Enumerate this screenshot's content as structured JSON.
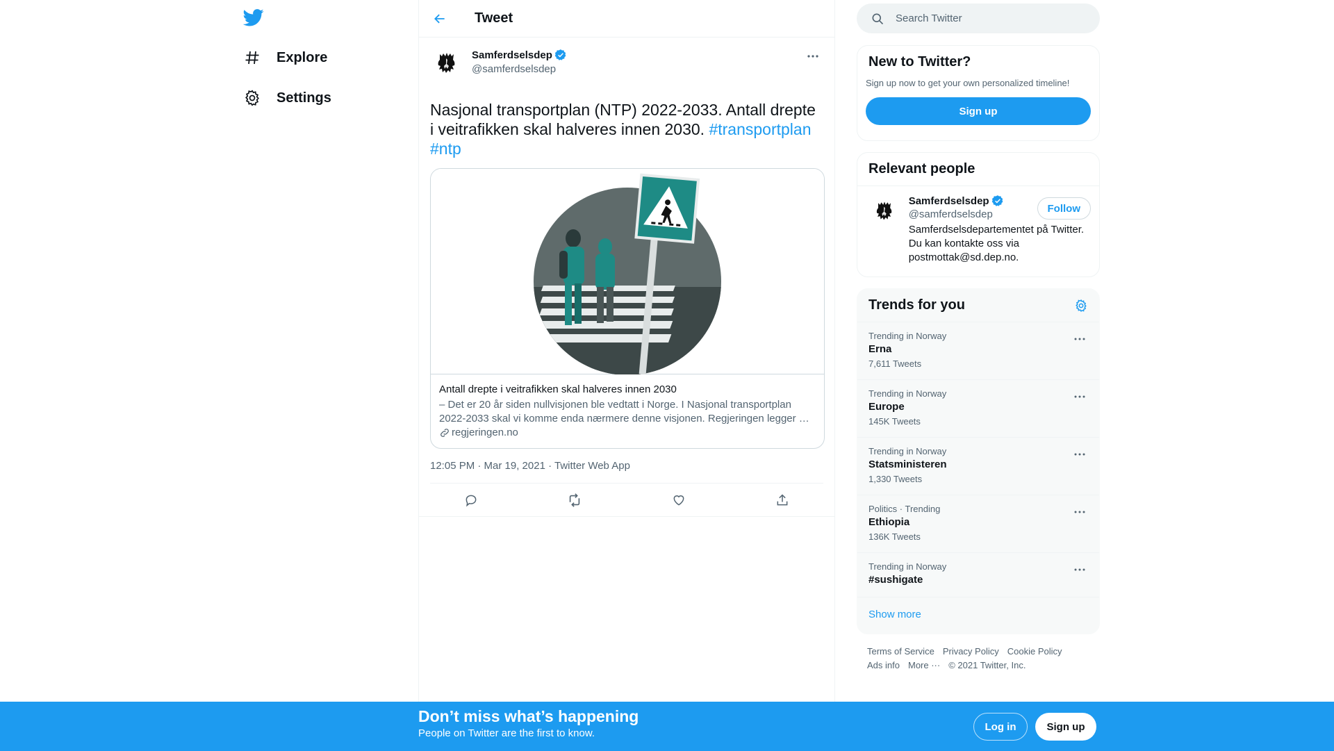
{
  "nav": {
    "explore_label": "Explore",
    "settings_label": "Settings"
  },
  "header": {
    "title": "Tweet"
  },
  "tweet": {
    "author_name": "Samferdselsdep",
    "author_handle": "@samferdselsdep",
    "text": "Nasjonal transportplan (NTP) 2022-2033. Antall drepte i veitrafikken skal halveres innen 2030. ",
    "hashtags": [
      "#transportplan",
      "#ntp"
    ],
    "card": {
      "title": "Antall drepte i veitrafikken skal halveres innen 2030",
      "description": "– Det er 20 år siden nullvisjonen ble vedtatt i Norge. I Nasjonal transportplan 2022-2033 skal vi komme enda nærmere denne visjonen. Regjeringen legger …",
      "domain": "regjeringen.no"
    },
    "timestamp": "12:05 PM · Mar 19, 2021 · Twitter Web App"
  },
  "search": {
    "placeholder": "Search Twitter"
  },
  "new_to_twitter": {
    "title": "New to Twitter?",
    "subtitle": "Sign up now to get your own personalized timeline!",
    "signup_label": "Sign up"
  },
  "relevant_people": {
    "title": "Relevant people",
    "person": {
      "name": "Samferdselsdep",
      "handle": "@samferdselsdep",
      "bio": "Samferdselsdepartementet på Twitter. Du kan kontakte oss via postmottak@sd.dep.no.",
      "follow_label": "Follow"
    }
  },
  "trends": {
    "title": "Trends for you",
    "items": [
      {
        "meta": "Trending in Norway",
        "name": "Erna",
        "count": "7,611 Tweets"
      },
      {
        "meta": "Trending in Norway",
        "name": "Europe",
        "count": "145K Tweets"
      },
      {
        "meta": "Trending in Norway",
        "name": "Statsministeren",
        "count": "1,330 Tweets"
      },
      {
        "meta": "Politics · Trending",
        "name": "Ethiopia",
        "count": "136K Tweets"
      },
      {
        "meta": "Trending in Norway",
        "name": "#sushigate",
        "count": ""
      }
    ],
    "show_more": "Show more"
  },
  "footer": {
    "links": [
      "Terms of Service",
      "Privacy Policy",
      "Cookie Policy",
      "Ads info",
      "More ···",
      "© 2021 Twitter, Inc."
    ]
  },
  "bottom_bar": {
    "title": "Don’t miss what’s happening",
    "subtitle": "People on Twitter are the first to know.",
    "login_label": "Log in",
    "signup_label": "Sign up"
  },
  "colors": {
    "accent": "#1d9bf0",
    "text_primary": "#0f1419",
    "text_secondary": "#536471"
  },
  "icons": [
    "twitter-bird-icon",
    "hashtag-icon",
    "gear-icon",
    "back-arrow-icon",
    "verified-icon",
    "more-dots-icon",
    "link-icon",
    "reply-icon",
    "retweet-icon",
    "like-icon",
    "share-icon",
    "search-icon"
  ]
}
